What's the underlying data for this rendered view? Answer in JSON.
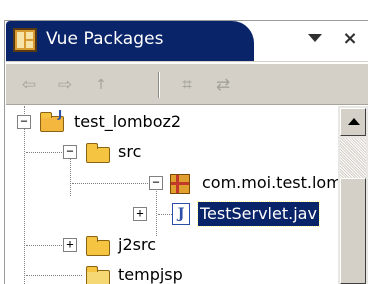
{
  "view": {
    "title": "Vue Packages",
    "icon": "package-explorer-icon",
    "menu_icon": "view-menu-chevron-icon",
    "close_glyph": "×",
    "active_color": "#0a246a"
  },
  "toolbar": {
    "back_glyph": "⇦",
    "forward_glyph": "⇨",
    "up_glyph": "↑",
    "collapse_all_glyph": "⌗",
    "link_editor_glyph": "⇄"
  },
  "tree": {
    "items": [
      {
        "label": "test_lomboz2",
        "icon": "java-project-icon",
        "expanded": true
      },
      {
        "label": "src",
        "icon": "source-folder-icon",
        "expanded": true
      },
      {
        "label": "com.moi.test.lomboz",
        "icon": "package-icon",
        "expanded": true
      },
      {
        "label": "TestServlet.jav",
        "icon": "java-file-icon",
        "expanded": false,
        "selected": true
      },
      {
        "label": "j2src",
        "icon": "source-folder-icon",
        "expanded": false
      },
      {
        "label": "tempjsp",
        "icon": "folder-icon",
        "expanded": false
      }
    ],
    "java_letter": "J",
    "project_mark": "J"
  },
  "toggle": {
    "expanded": "−",
    "collapsed": "+"
  }
}
